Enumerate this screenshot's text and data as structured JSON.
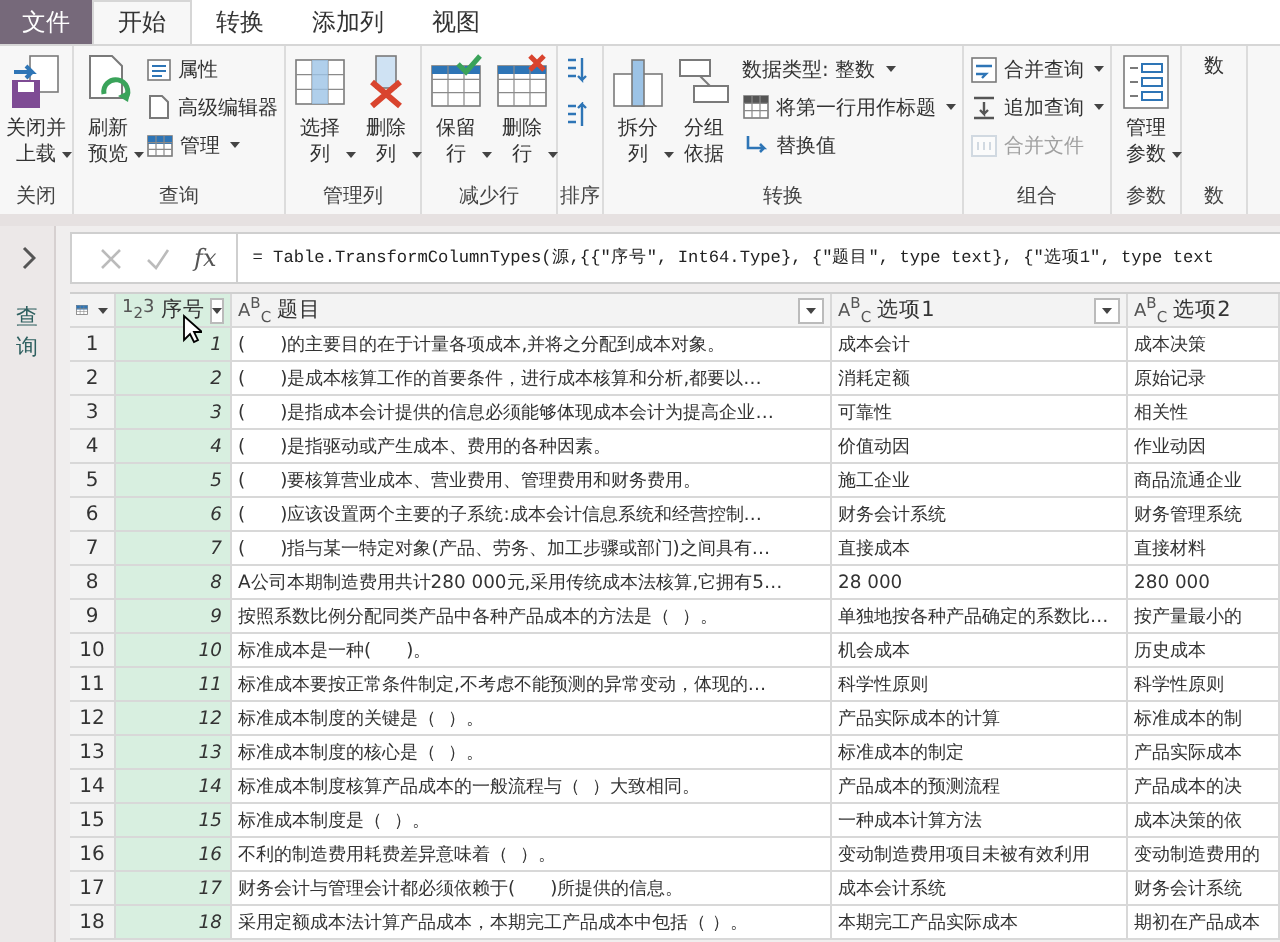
{
  "menu_tabs": [
    {
      "label": "文件",
      "kind": "file",
      "selected": false
    },
    {
      "label": "开始",
      "kind": "tab",
      "selected": true
    },
    {
      "label": "转换",
      "kind": "tab",
      "selected": false
    },
    {
      "label": "添加列",
      "kind": "tab",
      "selected": false
    },
    {
      "label": "视图",
      "kind": "tab",
      "selected": false
    }
  ],
  "ribbon_groups": [
    {
      "label": "关闭",
      "items": [
        {
          "kind": "large",
          "label": [
            "关闭并",
            "上载"
          ],
          "dropdown": true,
          "disabled": false
        }
      ]
    },
    {
      "label": "查询",
      "items": [
        {
          "kind": "large",
          "label": [
            "刷新",
            "预览"
          ],
          "dropdown": true,
          "disabled": false
        },
        {
          "kind": "small",
          "label": [
            "属性"
          ],
          "dropdown": false,
          "disabled": false
        },
        {
          "kind": "small",
          "label": [
            "高级编辑器"
          ],
          "dropdown": false,
          "disabled": false
        },
        {
          "kind": "small",
          "label": [
            "管理"
          ],
          "dropdown": true,
          "disabled": false
        }
      ]
    },
    {
      "label": "管理列",
      "items": [
        {
          "kind": "large",
          "label": [
            "选择",
            "列"
          ],
          "dropdown": true,
          "disabled": false
        },
        {
          "kind": "large",
          "label": [
            "删除",
            "列"
          ],
          "dropdown": true,
          "disabled": false
        }
      ]
    },
    {
      "label": "减少行",
      "items": [
        {
          "kind": "large",
          "label": [
            "保留",
            "行"
          ],
          "dropdown": true,
          "disabled": false
        },
        {
          "kind": "large",
          "label": [
            "删除",
            "行"
          ],
          "dropdown": true,
          "disabled": false
        }
      ]
    },
    {
      "label": "排序",
      "items": [
        {
          "kind": "icon",
          "dropdown": false,
          "disabled": false
        },
        {
          "kind": "icon",
          "dropdown": false,
          "disabled": false
        }
      ]
    },
    {
      "label": "转换",
      "items": [
        {
          "kind": "large",
          "label": [
            "拆分",
            "列"
          ],
          "dropdown": true,
          "disabled": false
        },
        {
          "kind": "large",
          "label": [
            "分组",
            "依据"
          ],
          "dropdown": false,
          "disabled": false
        },
        {
          "kind": "small",
          "label": [
            "数据类型: 整数"
          ],
          "dropdown": true,
          "disabled": false
        },
        {
          "kind": "small",
          "label": [
            "将第一行用作标题"
          ],
          "dropdown": true,
          "disabled": false
        },
        {
          "kind": "small",
          "label": [
            "替换值"
          ],
          "dropdown": false,
          "disabled": false
        }
      ]
    },
    {
      "label": "组合",
      "items": [
        {
          "kind": "small",
          "label": [
            "合并查询"
          ],
          "dropdown": true,
          "disabled": false
        },
        {
          "kind": "small",
          "label": [
            "追加查询"
          ],
          "dropdown": true,
          "disabled": false
        },
        {
          "kind": "small",
          "label": [
            "合并文件"
          ],
          "dropdown": false,
          "disabled": true
        }
      ]
    },
    {
      "label": "参数",
      "items": [
        {
          "kind": "large",
          "label": [
            "管理",
            "参数"
          ],
          "dropdown": true,
          "disabled": false
        }
      ]
    },
    {
      "label": "数",
      "items": [
        {
          "kind": "large",
          "label": [
            "数"
          ],
          "dropdown": false,
          "disabled": false
        }
      ]
    }
  ],
  "side_pane": {
    "label": "查询",
    "expanded": false
  },
  "formula_bar": {
    "fx_label": "fx",
    "formula": "= Table.TransformColumnTypes(源,{{\"序号\", Int64.Type}, {\"题目\", type text}, {\"选项1\", type text"
  },
  "table": {
    "columns": [
      {
        "name": "序号",
        "type": "1$_{2}$3",
        "selected": true,
        "filter_button": true
      },
      {
        "name": "题目",
        "type": "A$^{B}$$_{C}$",
        "selected": false,
        "filter_button": true
      },
      {
        "name": "选项1",
        "type": "A$^{B}$$_{C}$",
        "selected": false,
        "filter_button": true
      },
      {
        "name": "选项2",
        "type": "A$^{B}$$_{C}$",
        "selected": false,
        "filter_button": false
      }
    ],
    "rows": [
      {
        "number": "1",
        "cells": [
          "1",
          "(      )的主要目的在于计量各项成本,并将之分配到成本对象。",
          "成本会计",
          "成本决策"
        ]
      },
      {
        "number": "2",
        "cells": [
          "2",
          "(      )是成本核算工作的首要条件，进行成本核算和分析,都要以…",
          "消耗定额",
          "原始记录"
        ]
      },
      {
        "number": "3",
        "cells": [
          "3",
          "(      )是指成本会计提供的信息必须能够体现成本会计为提高企业…",
          "可靠性",
          "相关性"
        ]
      },
      {
        "number": "4",
        "cells": [
          "4",
          "(      )是指驱动或产生成本、费用的各种因素。",
          "价值动因",
          "作业动因"
        ]
      },
      {
        "number": "5",
        "cells": [
          "5",
          "(      )要核算营业成本、营业费用、管理费用和财务费用。",
          "施工企业",
          "商品流通企业"
        ]
      },
      {
        "number": "6",
        "cells": [
          "6",
          "(      )应该设置两个主要的子系统:成本会计信息系统和经营控制…",
          "财务会计系统",
          "财务管理系统"
        ]
      },
      {
        "number": "7",
        "cells": [
          "7",
          "(      )指与某一特定对象(产品、劳务、加工步骤或部门)之间具有…",
          "直接成本",
          "直接材料"
        ]
      },
      {
        "number": "8",
        "cells": [
          "8",
          "A公司本期制造费用共计280 000元,采用传统成本法核算,它拥有5…",
          "28 000",
          "280 000"
        ]
      },
      {
        "number": "9",
        "cells": [
          "9",
          "按照系数比例分配同类产品中各种产品成本的方法是（  ）。",
          "单独地按各种产品确定的系数比…",
          "按产量最小的"
        ]
      },
      {
        "number": "10",
        "cells": [
          "10",
          "标准成本是一种(      )。",
          "机会成本",
          "历史成本"
        ]
      },
      {
        "number": "11",
        "cells": [
          "11",
          "标准成本要按正常条件制定,不考虑不能预测的异常变动，体现的…",
          "科学性原则",
          "科学性原则"
        ]
      },
      {
        "number": "12",
        "cells": [
          "12",
          "标准成本制度的关键是（  ）。",
          "产品实际成本的计算",
          "标准成本的制"
        ]
      },
      {
        "number": "13",
        "cells": [
          "13",
          "标准成本制度的核心是（  ）。",
          "标准成本的制定",
          "产品实际成本"
        ]
      },
      {
        "number": "14",
        "cells": [
          "14",
          "标准成本制度核算产品成本的一般流程与（  ）大致相同。",
          "产品成本的预测流程",
          "产品成本的决"
        ]
      },
      {
        "number": "15",
        "cells": [
          "15",
          "标准成本制度是（  ）。",
          "一种成本计算方法",
          "成本决策的依"
        ]
      },
      {
        "number": "16",
        "cells": [
          "16",
          "不利的制造费用耗费差异意味着（  ）。",
          "变动制造费用项目未被有效利用",
          "变动制造费用的"
        ]
      },
      {
        "number": "17",
        "cells": [
          "17",
          "财务会计与管理会计都必须依赖于(      )所提供的信息。",
          "成本会计系统",
          "财务会计系统"
        ]
      },
      {
        "number": "18",
        "cells": [
          "18",
          "采用定额成本法计算产品成本，本期完工产品成本中包括（ ）。",
          "本期完工产品实际成本",
          "期初在产品成本"
        ]
      }
    ]
  }
}
